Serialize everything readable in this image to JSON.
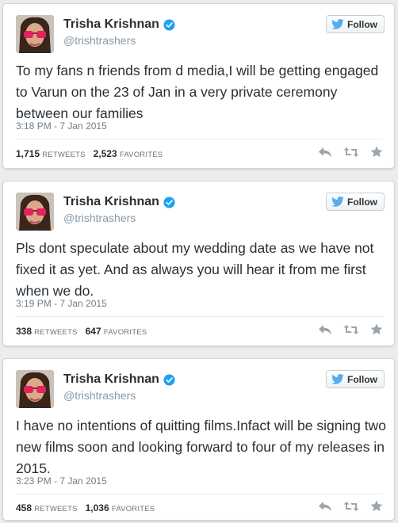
{
  "tweets": [
    {
      "name": "Trisha Krishnan",
      "handle": "@trishtrashers",
      "follow_label": "Follow",
      "text": "To my fans n friends from d media,I will be getting engaged to Varun on the 23 of Jan in a very private ceremony between our families",
      "timestamp": "3:18 PM - 7 Jan 2015",
      "retweets": "1,715",
      "retweets_label": "RETWEETS",
      "favorites": "2,523",
      "favorites_label": "FAVORITES"
    },
    {
      "name": "Trisha Krishnan",
      "handle": "@trishtrashers",
      "follow_label": "Follow",
      "text": "Pls dont speculate about my wedding date as we have not fixed it as yet. And as always you will hear it from me first when we do.",
      "timestamp": "3:19 PM - 7 Jan 2015",
      "retweets": "338",
      "retweets_label": "RETWEETS",
      "favorites": "647",
      "favorites_label": "FAVORITES"
    },
    {
      "name": "Trisha Krishnan",
      "handle": "@trishtrashers",
      "follow_label": "Follow",
      "text": "I have no intentions of quitting films.Infact will be signing two new films soon and looking forward to four of my releases in 2015.",
      "timestamp": "3:23 PM - 7 Jan 2015",
      "retweets": "458",
      "retweets_label": "RETWEETS",
      "favorites": "1,036",
      "favorites_label": "FAVORITES"
    }
  ],
  "icons": {
    "verified": "verified-badge-icon",
    "follow": "twitter-bird-icon",
    "reply": "reply-icon",
    "retweet": "retweet-icon",
    "favorite": "star-icon"
  },
  "colors": {
    "twitter_blue": "#55acee",
    "verified_blue": "#1da1f2",
    "action_gray": "#9aa5ad"
  }
}
